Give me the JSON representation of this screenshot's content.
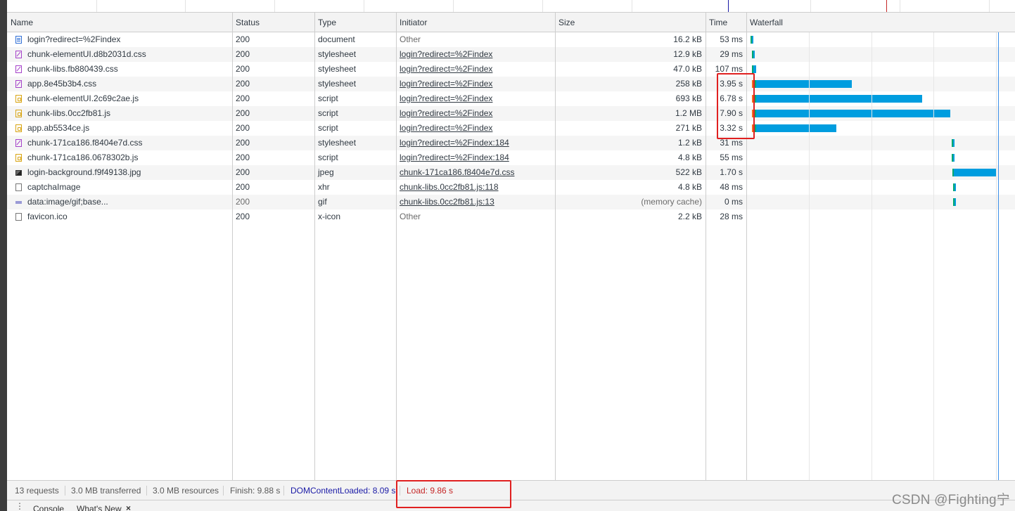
{
  "columns": {
    "name": "Name",
    "status": "Status",
    "type": "Type",
    "initiator": "Initiator",
    "size": "Size",
    "time": "Time",
    "waterfall": "Waterfall"
  },
  "requests": [
    {
      "name": "login?redirect=%2Findex",
      "icon": "document-icon",
      "status": "200",
      "type": "document",
      "initiator": "Other",
      "initiator_link": false,
      "size": "16.2 kB",
      "time": "53 ms"
    },
    {
      "name": "chunk-elementUI.d8b2031d.css",
      "icon": "stylesheet-icon",
      "status": "200",
      "type": "stylesheet",
      "initiator": "login?redirect=%2Findex",
      "initiator_link": true,
      "size": "12.9 kB",
      "time": "29 ms"
    },
    {
      "name": "chunk-libs.fb880439.css",
      "icon": "stylesheet-icon",
      "status": "200",
      "type": "stylesheet",
      "initiator": "login?redirect=%2Findex",
      "initiator_link": true,
      "size": "47.0 kB",
      "time": "107 ms"
    },
    {
      "name": "app.8e45b3b4.css",
      "icon": "stylesheet-icon",
      "status": "200",
      "type": "stylesheet",
      "initiator": "login?redirect=%2Findex",
      "initiator_link": true,
      "size": "258 kB",
      "time": "3.95 s"
    },
    {
      "name": "chunk-elementUI.2c69c2ae.js",
      "icon": "script-icon",
      "status": "200",
      "type": "script",
      "initiator": "login?redirect=%2Findex",
      "initiator_link": true,
      "size": "693 kB",
      "time": "6.78 s"
    },
    {
      "name": "chunk-libs.0cc2fb81.js",
      "icon": "script-icon",
      "status": "200",
      "type": "script",
      "initiator": "login?redirect=%2Findex",
      "initiator_link": true,
      "size": "1.2 MB",
      "time": "7.90 s"
    },
    {
      "name": "app.ab5534ce.js",
      "icon": "script-icon",
      "status": "200",
      "type": "script",
      "initiator": "login?redirect=%2Findex",
      "initiator_link": true,
      "size": "271 kB",
      "time": "3.32 s"
    },
    {
      "name": "chunk-171ca186.f8404e7d.css",
      "icon": "stylesheet-icon",
      "status": "200",
      "type": "stylesheet",
      "initiator": "login?redirect=%2Findex:184",
      "initiator_link": true,
      "size": "1.2 kB",
      "time": "31 ms"
    },
    {
      "name": "chunk-171ca186.0678302b.js",
      "icon": "script-icon",
      "status": "200",
      "type": "script",
      "initiator": "login?redirect=%2Findex:184",
      "initiator_link": true,
      "size": "4.8 kB",
      "time": "55 ms"
    },
    {
      "name": "login-background.f9f49138.jpg",
      "icon": "image-icon",
      "status": "200",
      "type": "jpeg",
      "initiator": "chunk-171ca186.f8404e7d.css",
      "initiator_link": true,
      "size": "522 kB",
      "time": "1.70 s"
    },
    {
      "name": "captchaImage",
      "icon": "xhr-icon",
      "status": "200",
      "type": "xhr",
      "initiator": "chunk-libs.0cc2fb81.js:118",
      "initiator_link": true,
      "size": "4.8 kB",
      "time": "48 ms"
    },
    {
      "name": "data:image/gif;base...",
      "icon": "gif-icon",
      "status": "200",
      "type": "gif",
      "initiator": "chunk-libs.0cc2fb81.js:13",
      "initiator_link": true,
      "size": "(memory cache)",
      "time": "0 ms",
      "muted": true
    },
    {
      "name": "favicon.ico",
      "icon": "file-icon",
      "status": "200",
      "type": "x-icon",
      "initiator": "Other",
      "initiator_link": false,
      "size": "2.2 kB",
      "time": "28 ms"
    }
  ],
  "waterfall_timing_seconds": [
    {
      "start": 0.0,
      "wait": 0.02,
      "download": 0.03
    },
    {
      "start": 0.06,
      "wait": 0.0,
      "download": 0.03
    },
    {
      "start": 0.06,
      "wait": 0.0,
      "download": 0.11
    },
    {
      "start": 0.07,
      "wait": 0.03,
      "download": 3.85
    },
    {
      "start": 0.07,
      "wait": 0.03,
      "download": 6.68
    },
    {
      "start": 0.07,
      "wait": 0.03,
      "download": 7.8
    },
    {
      "start": 0.07,
      "wait": 0.03,
      "download": 3.22
    },
    {
      "start": 8.1,
      "wait": 0.0,
      "download": 0.03
    },
    {
      "start": 8.1,
      "wait": 0.0,
      "download": 0.05
    },
    {
      "start": 8.14,
      "wait": 0.0,
      "download": 1.7
    },
    {
      "start": 8.15,
      "wait": 0.0,
      "download": 0.05
    },
    {
      "start": 8.16,
      "wait": 0.0,
      "download": 0.01
    },
    {
      "start": null,
      "wait": 0,
      "download": 0
    }
  ],
  "summary": {
    "requests": "13 requests",
    "transferred": "3.0 MB transferred",
    "resources": "3.0 MB resources",
    "finish": "Finish: 9.88 s",
    "dom_content_loaded": "DOMContentLoaded: 8.09 s",
    "load": "Load: 9.86 s"
  },
  "drawer": {
    "console_tab": "Console",
    "whats_new_tab": "What's New"
  },
  "watermark": "CSDN @Fighting宁",
  "colors": {
    "waiting": "#00a870",
    "download": "#009ddf",
    "queue": "#f26d21",
    "dcl_line": "#1a1aa6",
    "load_line": "#c52828",
    "highlight": "#e02020"
  }
}
